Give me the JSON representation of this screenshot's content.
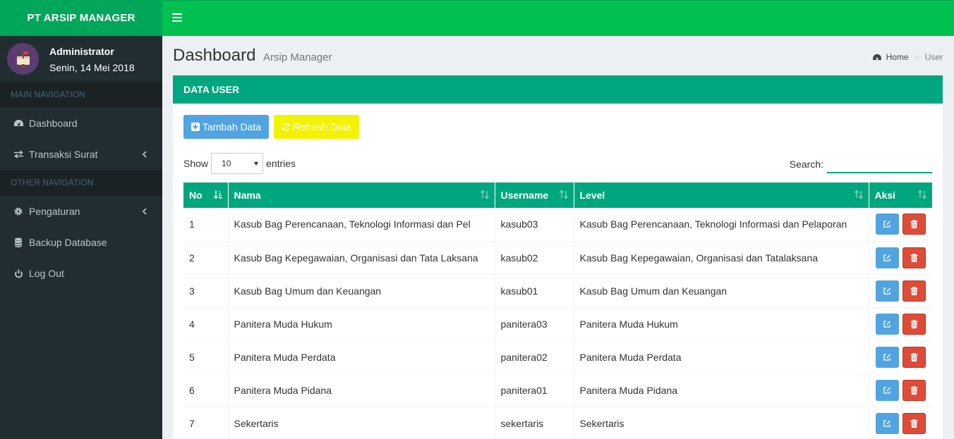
{
  "app": {
    "title": "PT ARSIP MANAGER"
  },
  "user": {
    "name": "Administrator",
    "date": "Senin, 14 Mei 2018"
  },
  "sidebar": {
    "main_header": "MAIN NAVIGATION",
    "other_header": "OTHER NAVIGATION",
    "items": [
      {
        "label": "Dashboard",
        "icon": "dashboard-icon"
      },
      {
        "label": "Transaksi Surat",
        "icon": "exchange-icon"
      },
      {
        "label": "Pengaturan",
        "icon": "gear-icon"
      },
      {
        "label": "Backup Database",
        "icon": "database-icon"
      },
      {
        "label": "Log Out",
        "icon": "power-icon"
      }
    ]
  },
  "page": {
    "title": "Dashboard",
    "subtitle": "Arsip Manager",
    "breadcrumb": {
      "home": "Home",
      "current": "User"
    }
  },
  "box": {
    "title": "DATA USER",
    "add_label": "Tambah Data",
    "refresh_label": "Refresh Data",
    "show_label": "Show",
    "entries_value": "10",
    "entries_label": "entries",
    "search_label": "Search:"
  },
  "table": {
    "columns": [
      "No",
      "Nama",
      "Username",
      "Level",
      "Aksi"
    ],
    "rows": [
      {
        "no": "1",
        "nama": "Kasub Bag Perencanaan, Teknologi Informasi dan Pel",
        "username": "kasub03",
        "level": "Kasub Bag Perencanaan, Teknologi Informasi dan Pelaporan"
      },
      {
        "no": "2",
        "nama": "Kasub Bag Kepegawaian, Organisasi dan Tata Laksana",
        "username": "kasub02",
        "level": "Kasub Bag Kepegawaian, Organisasi dan Tatalaksana"
      },
      {
        "no": "3",
        "nama": "Kasub Bag Umum dan Keuangan",
        "username": "kasub01",
        "level": "Kasub Bag Umum dan Keuangan"
      },
      {
        "no": "4",
        "nama": "Panitera Muda Hukum",
        "username": "panitera03",
        "level": "Panitera Muda Hukum"
      },
      {
        "no": "5",
        "nama": "Panitera Muda Perdata",
        "username": "panitera02",
        "level": "Panitera Muda Perdata"
      },
      {
        "no": "6",
        "nama": "Panitera Muda Pidana",
        "username": "panitera01",
        "level": "Panitera Muda Pidana"
      },
      {
        "no": "7",
        "nama": "Sekertaris",
        "username": "sekertaris",
        "level": "Sekertaris"
      }
    ]
  },
  "colors": {
    "green": "#00a65a",
    "navbar": "#00c14f",
    "teal": "#00a67e",
    "sidebar": "#222d32",
    "blue": "#52a4e0",
    "yellow": "#f3f300",
    "red": "#dd4b39"
  }
}
